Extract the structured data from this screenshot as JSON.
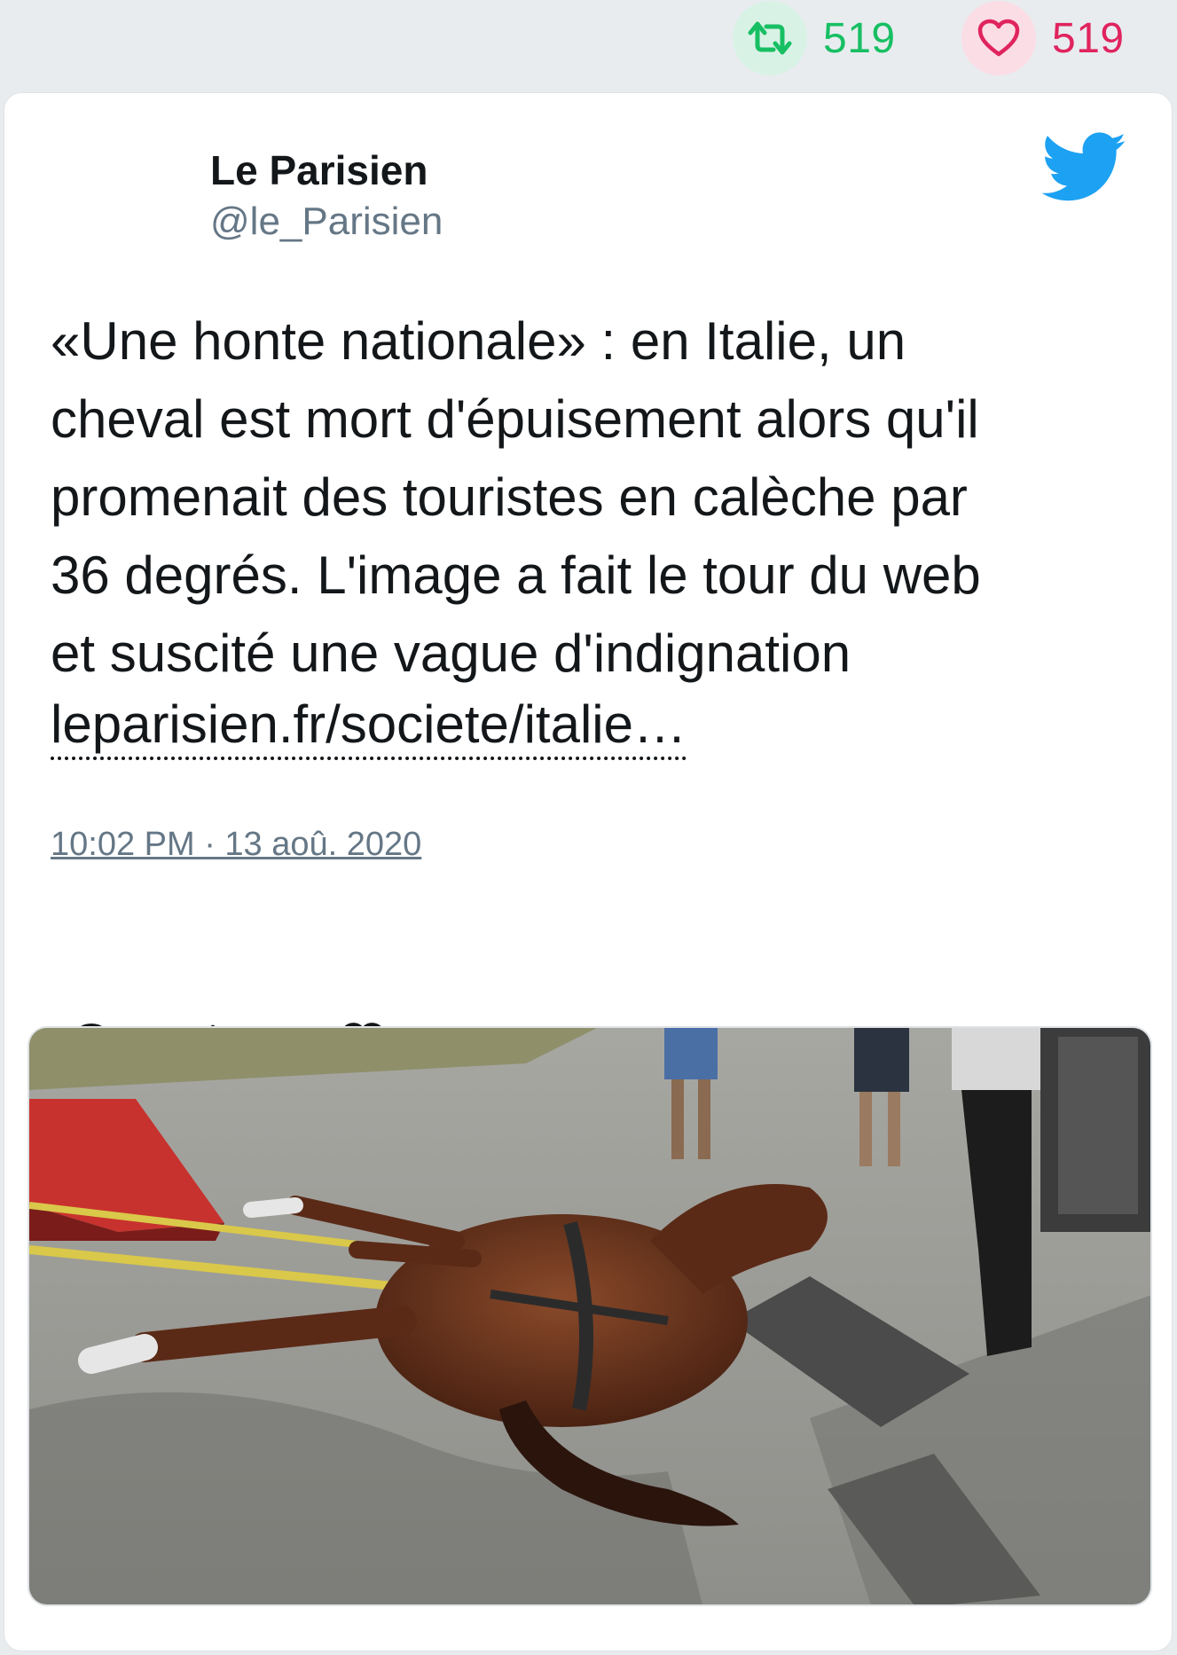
{
  "stats": {
    "retweets": "519",
    "likes": "519",
    "retweet_icon": "retweet-icon",
    "like_icon": "heart-icon"
  },
  "tweet": {
    "author_name": "Le Parisien",
    "author_handle": "@le_Parisien",
    "text": "«Une honte nationale» : en Italie, un\ncheval est mort d'épuisement alors qu'il\npromenait des touristes en calèche par\n36 degrés. L'image a fait le tour du web\net suscité une vague d'indignation",
    "link": "leparisien.fr/societe/italie…",
    "timestamp": "10:02 PM · 13 aoû. 2020"
  },
  "actions": {
    "reply_icon": "reply-icon",
    "retweet_icon": "retweet-icon",
    "like_icon": "heart-icon"
  },
  "colors": {
    "retweet_green": "#17bf63",
    "like_red": "#e0245e",
    "twitter_blue": "#1da1f2",
    "meta_gray": "#657786"
  }
}
